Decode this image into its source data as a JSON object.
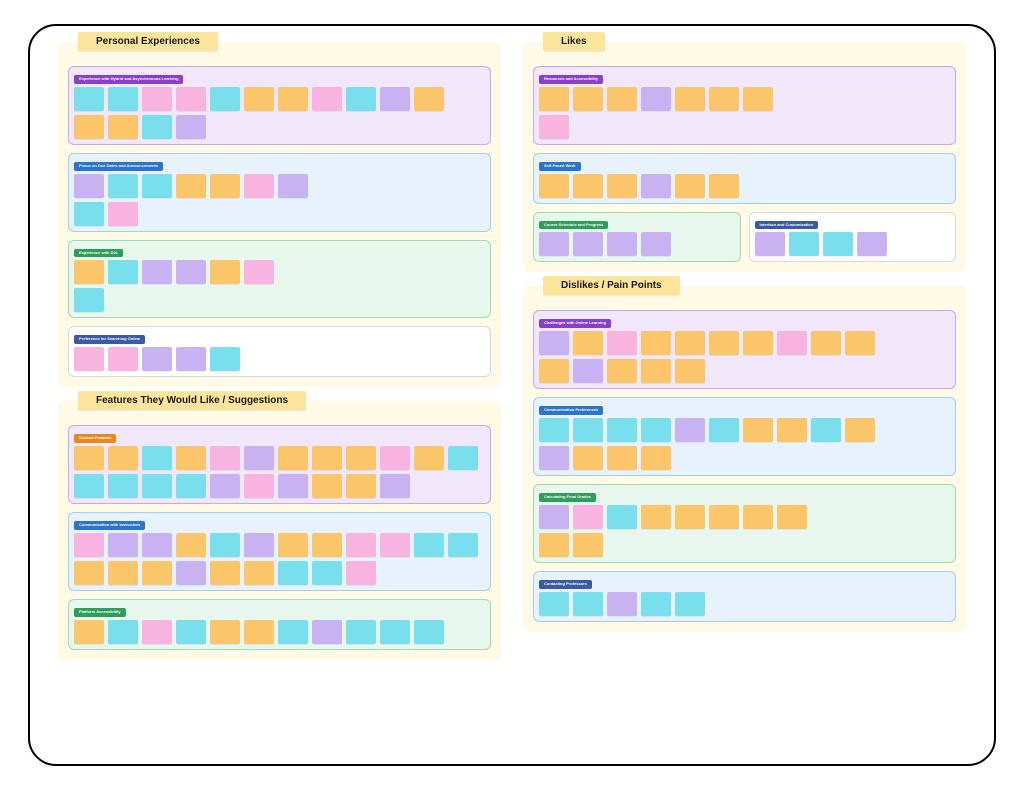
{
  "colors": {
    "section_bg": "#FFFAE6",
    "section_title_bg": "#FBE59D",
    "sticky": {
      "cyan": "#7ADFEC",
      "pink": "#F8B3E1",
      "orange": "#FBC56A",
      "lavender": "#C9B2F2"
    },
    "cluster_bg": {
      "lavender": "#F0E7FB",
      "blue": "#E7F2FD",
      "mint": "#E8F7EE",
      "white": "#FFFFFF"
    }
  },
  "columns": [
    {
      "sections": [
        {
          "title": "Personal Experiences",
          "groups": [
            {
              "label": "Experience with Hybrid and Asynchronous Learning",
              "bg": "bg-lav",
              "label_color": "lb-purple",
              "rows": [
                [
                  "c-cyan",
                  "c-cyan",
                  "c-pink",
                  "c-pink",
                  "c-cyan",
                  "c-orange",
                  "c-orange",
                  "c-pink",
                  "c-cyan",
                  "c-lav",
                  "c-orange"
                ],
                [
                  "c-orange",
                  "c-orange",
                  "c-cyan",
                  "c-lav"
                ]
              ]
            },
            {
              "label": "Focus on Due Dates and Announcements",
              "bg": "bg-blue",
              "label_color": "lb-blue",
              "rows": [
                [
                  "c-lav",
                  "c-cyan",
                  "c-cyan",
                  "c-orange",
                  "c-orange",
                  "c-pink",
                  "c-lav"
                ],
                [
                  "c-cyan",
                  "c-pink"
                ]
              ]
            },
            {
              "label": "Experience with D2L",
              "bg": "bg-mint",
              "label_color": "lb-green",
              "rows": [
                [
                  "c-orange",
                  "c-cyan",
                  "c-lav",
                  "c-lav",
                  "c-orange",
                  "c-pink"
                ],
                [
                  "c-cyan"
                ]
              ]
            },
            {
              "label": "Preference for Searching Online",
              "bg": "bg-wht",
              "label_color": "lb-navy",
              "rows": [
                [
                  "c-pink",
                  "c-pink",
                  "c-lav",
                  "c-lav",
                  "c-cyan"
                ]
              ]
            }
          ]
        },
        {
          "title": "Features They Would Like / Suggestions",
          "groups": [
            {
              "label": "Desired Features",
              "bg": "bg-lav",
              "label_color": "lb-orange",
              "rows": [
                [
                  "c-orange",
                  "c-orange",
                  "c-cyan",
                  "c-orange",
                  "c-pink",
                  "c-lav",
                  "c-orange",
                  "c-orange",
                  "c-orange",
                  "c-pink",
                  "c-orange",
                  "c-cyan"
                ],
                [
                  "c-cyan",
                  "c-cyan",
                  "c-cyan",
                  "c-cyan",
                  "c-lav",
                  "c-pink",
                  "c-lav",
                  "c-orange",
                  "c-orange",
                  "c-lav"
                ]
              ]
            },
            {
              "label": "Communication with Instructors",
              "bg": "bg-blue",
              "label_color": "lb-blue",
              "rows": [
                [
                  "c-pink",
                  "c-lav",
                  "c-lav",
                  "c-orange",
                  "c-cyan",
                  "c-lav",
                  "c-orange",
                  "c-orange",
                  "c-pink",
                  "c-pink",
                  "c-cyan",
                  "c-cyan"
                ],
                [
                  "c-orange",
                  "c-orange",
                  "c-orange",
                  "c-lav",
                  "c-orange",
                  "c-orange",
                  "c-cyan",
                  "c-cyan",
                  "c-pink"
                ]
              ]
            },
            {
              "label": "Platform Accessibility",
              "bg": "bg-mint",
              "label_color": "lb-green",
              "rows": [
                [
                  "c-orange",
                  "c-cyan",
                  "c-pink",
                  "c-cyan",
                  "c-orange",
                  "c-orange",
                  "c-cyan",
                  "c-lav",
                  "c-cyan",
                  "c-cyan",
                  "c-cyan"
                ]
              ]
            }
          ]
        }
      ]
    },
    {
      "sections": [
        {
          "title": "Likes",
          "groups": [
            {
              "label": "Resources and Accessibility",
              "bg": "bg-lav",
              "label_color": "lb-purple",
              "rows": [
                [
                  "c-orange",
                  "c-orange",
                  "c-orange",
                  "c-lav",
                  "c-orange",
                  "c-orange",
                  "c-orange"
                ],
                [
                  "c-pink"
                ]
              ]
            },
            {
              "label": "Self-Paced Work",
              "bg": "bg-blue",
              "label_color": "lb-blue",
              "rows": [
                [
                  "c-orange",
                  "c-orange",
                  "c-orange",
                  "c-lav",
                  "c-orange",
                  "c-orange"
                ]
              ]
            },
            {
              "pair": [
                {
                  "label": "Course Schedule and Progress",
                  "bg": "bg-mint",
                  "label_color": "lb-green",
                  "rows": [
                    [
                      "c-lav",
                      "c-lav",
                      "c-lav",
                      "c-lav"
                    ]
                  ]
                },
                {
                  "label": "Interface and Customization",
                  "bg": "bg-wht",
                  "label_color": "lb-navy",
                  "rows": [
                    [
                      "c-lav",
                      "c-cyan",
                      "c-cyan",
                      "c-lav"
                    ]
                  ]
                }
              ]
            }
          ]
        },
        {
          "title": "Dislikes / Pain Points",
          "groups": [
            {
              "label": "Challenges with Online Learning",
              "bg": "bg-lav",
              "label_color": "lb-purple",
              "rows": [
                [
                  "c-lav",
                  "c-orange",
                  "c-pink",
                  "c-orange",
                  "c-orange",
                  "c-orange",
                  "c-orange",
                  "c-pink",
                  "c-orange",
                  "c-orange"
                ],
                [
                  "c-orange",
                  "c-lav",
                  "c-orange",
                  "c-orange",
                  "c-orange"
                ]
              ]
            },
            {
              "label": "Communication Preferences",
              "bg": "bg-blue",
              "label_color": "lb-blue",
              "rows": [
                [
                  "c-cyan",
                  "c-cyan",
                  "c-cyan",
                  "c-cyan",
                  "c-lav",
                  "c-cyan",
                  "c-orange",
                  "c-orange",
                  "c-cyan",
                  "c-orange"
                ],
                [
                  "c-lav",
                  "c-orange",
                  "c-orange",
                  "c-orange"
                ]
              ]
            },
            {
              "label": "Calculating Final Grades",
              "bg": "bg-mint",
              "label_color": "lb-green",
              "rows": [
                [
                  "c-lav",
                  "c-pink",
                  "c-cyan",
                  "c-orange",
                  "c-orange",
                  "c-orange",
                  "c-orange",
                  "c-orange"
                ],
                [
                  "c-orange",
                  "c-orange"
                ]
              ]
            },
            {
              "label": "Contacting Professors",
              "bg": "bg-blue",
              "label_color": "lb-navy",
              "rows": [
                [
                  "c-cyan",
                  "c-cyan",
                  "c-lav",
                  "c-cyan",
                  "c-cyan"
                ]
              ]
            }
          ]
        }
      ]
    }
  ]
}
